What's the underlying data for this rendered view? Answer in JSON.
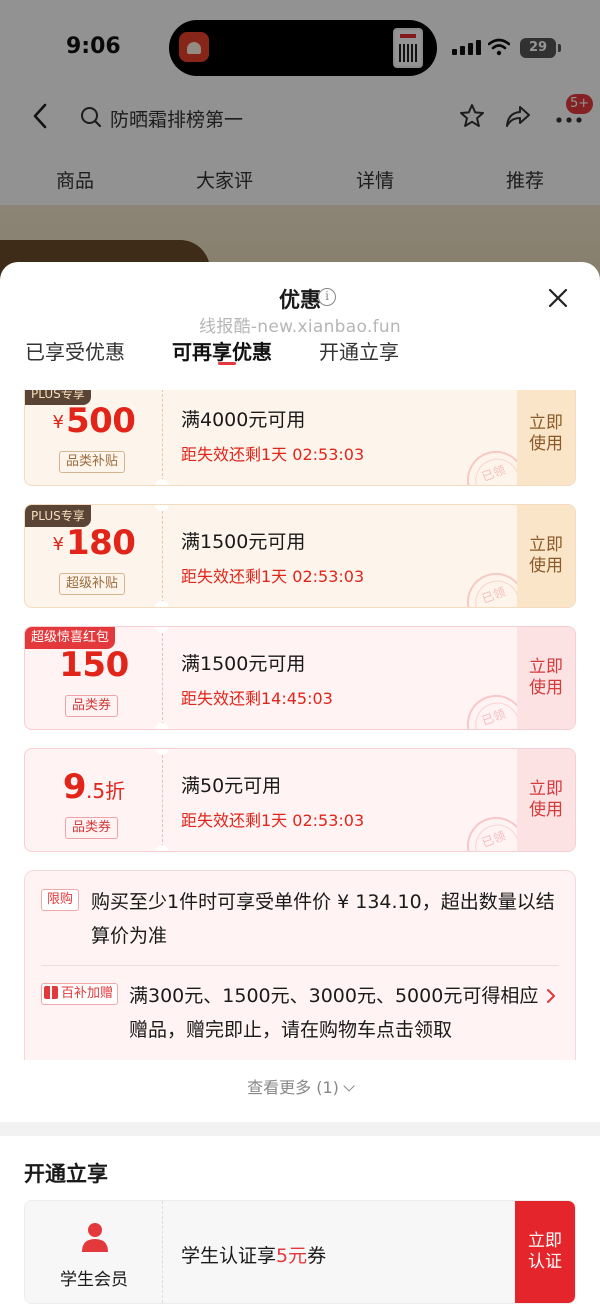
{
  "status_bar": {
    "time": "9:06",
    "battery": "29"
  },
  "nav": {
    "search_placeholder": "防晒霜排榜第一",
    "message_badge": "5+"
  },
  "product_tabs": [
    "商品",
    "大家评",
    "详情",
    "推荐"
  ],
  "sheet": {
    "title": "优惠",
    "info_glyph": "i",
    "watermark": "线报酷-new.xianbao.fun",
    "tabs": [
      "已享受优惠",
      "可再享优惠",
      "开通立享"
    ],
    "active_tab": "可再享优惠",
    "coupons": [
      {
        "tag": "PLUS专享",
        "currency": "¥",
        "amount": "500",
        "suffix": "",
        "type": "品类补贴",
        "condition": "满4000元可用",
        "expire": "距失效还剩1天 02:53:03",
        "action_line1": "立即",
        "action_line2": "使用",
        "stamp": "已领"
      },
      {
        "tag": "PLUS专享",
        "currency": "¥",
        "amount": "180",
        "suffix": "",
        "type": "超级补贴",
        "condition": "满1500元可用",
        "expire": "距失效还剩1天 02:53:03",
        "action_line1": "立即",
        "action_line2": "使用",
        "stamp": "已领"
      },
      {
        "tag": "超级惊喜红包",
        "currency": "",
        "amount": "150",
        "suffix": "",
        "type": "品类券",
        "condition": "满1500元可用",
        "expire": "距失效还剩14:45:03",
        "action_line1": "立即",
        "action_line2": "使用",
        "stamp": "已领"
      },
      {
        "tag": "",
        "currency": "",
        "amount": "9",
        "suffix": ".5折",
        "type": "品类券",
        "condition": "满50元可用",
        "expire": "距失效还剩1天 02:53:03",
        "action_line1": "立即",
        "action_line2": "使用",
        "stamp": "已领"
      }
    ],
    "promo": {
      "limit_tag": "限购",
      "limit_text": "购买至少1件时可享受单件价 ¥ 134.10，超出数量以结算价为准",
      "gift_tag": "百补加赠",
      "gift_text": "满300元、1500元、3000元、5000元可得相应赠品，赠完即止，请在购物车点击领取"
    },
    "see_more": "查看更多 (1)"
  },
  "open_section": {
    "title": "开通立享",
    "member_name": "学生会员",
    "offer_prefix": "学生认证享",
    "offer_highlight": "5元",
    "offer_suffix": "券",
    "action_line1": "立即",
    "action_line2": "认证"
  },
  "colors": {
    "accent_red": "#e4393c",
    "plus_gold": "#8a5a2a",
    "price_red": "#e1251b"
  }
}
